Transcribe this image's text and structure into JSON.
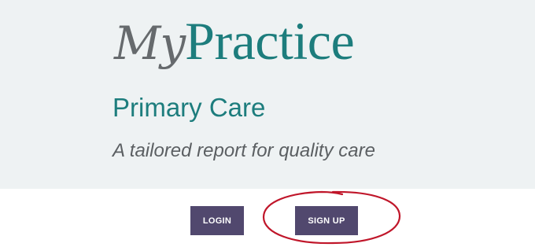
{
  "brand": {
    "my": "My",
    "practice": "Practice",
    "subtitle": "Primary Care",
    "tagline": "A tailored report for quality care"
  },
  "actions": {
    "login_label": "LOGIN",
    "signup_label": "SIGN UP"
  },
  "colors": {
    "hero_bg": "#eef2f3",
    "brand_teal": "#1d7d7d",
    "brand_gray": "#666a6d",
    "button_purple": "#51486e",
    "annotation_red": "#c0162a"
  },
  "annotation": {
    "type": "hand-drawn-circle",
    "target": "signup-button"
  }
}
